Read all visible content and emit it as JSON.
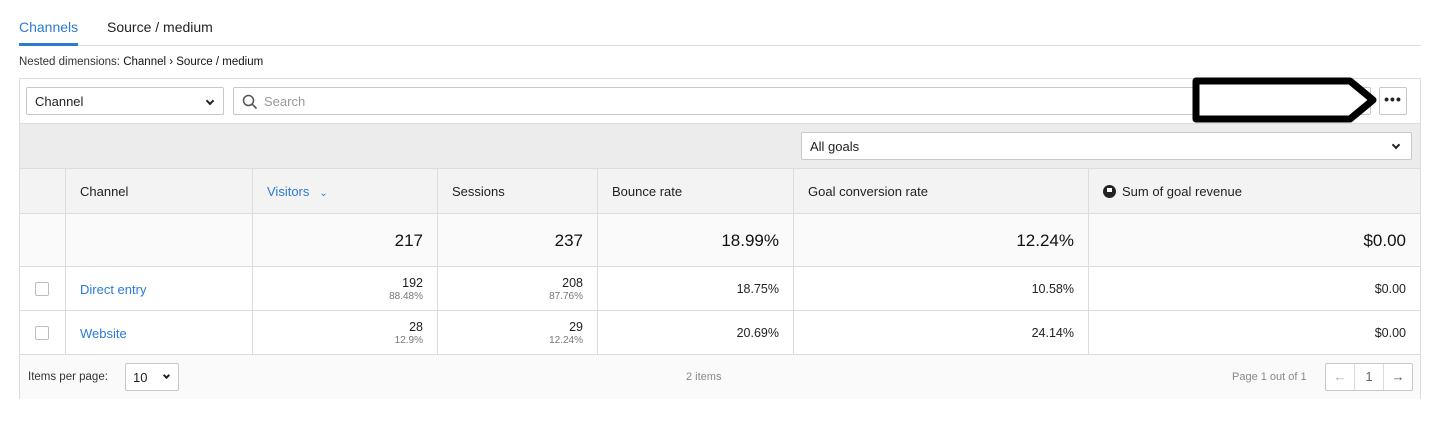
{
  "tabs": [
    {
      "label": "Channels",
      "active": true
    },
    {
      "label": "Source / medium",
      "active": false
    }
  ],
  "nested": {
    "prefix": "Nested dimensions:",
    "path": "Channel › Source / medium"
  },
  "toolbar": {
    "dimension_select": "Channel",
    "search_placeholder": "Search",
    "more_label": "•••"
  },
  "goals": {
    "selected": "All goals"
  },
  "table": {
    "headers": {
      "channel": "Channel",
      "visitors": "Visitors",
      "sessions": "Sessions",
      "bounce_rate": "Bounce rate",
      "goal_conversion_rate": "Goal conversion rate",
      "sum_goal_revenue": "Sum of goal revenue"
    },
    "totals": {
      "visitors": "217",
      "sessions": "237",
      "bounce_rate": "18.99%",
      "goal_conversion_rate": "12.24%",
      "sum_goal_revenue": "$0.00"
    },
    "rows": [
      {
        "channel": "Direct entry",
        "visitors": "192",
        "visitors_pct": "88.48%",
        "sessions": "208",
        "sessions_pct": "87.76%",
        "bounce_rate": "18.75%",
        "goal_conversion_rate": "10.58%",
        "sum_goal_revenue": "$0.00"
      },
      {
        "channel": "Website",
        "visitors": "28",
        "visitors_pct": "12.9%",
        "sessions": "29",
        "sessions_pct": "12.24%",
        "bounce_rate": "20.69%",
        "goal_conversion_rate": "24.14%",
        "sum_goal_revenue": "$0.00"
      }
    ]
  },
  "footer": {
    "items_per_page_label": "Items per page:",
    "items_per_page": "10",
    "items_count": "2 items",
    "page_info": "Page 1 out of 1",
    "current_page": "1"
  },
  "colors": {
    "accent": "#2b7bd6",
    "border": "#dcdcdc"
  }
}
